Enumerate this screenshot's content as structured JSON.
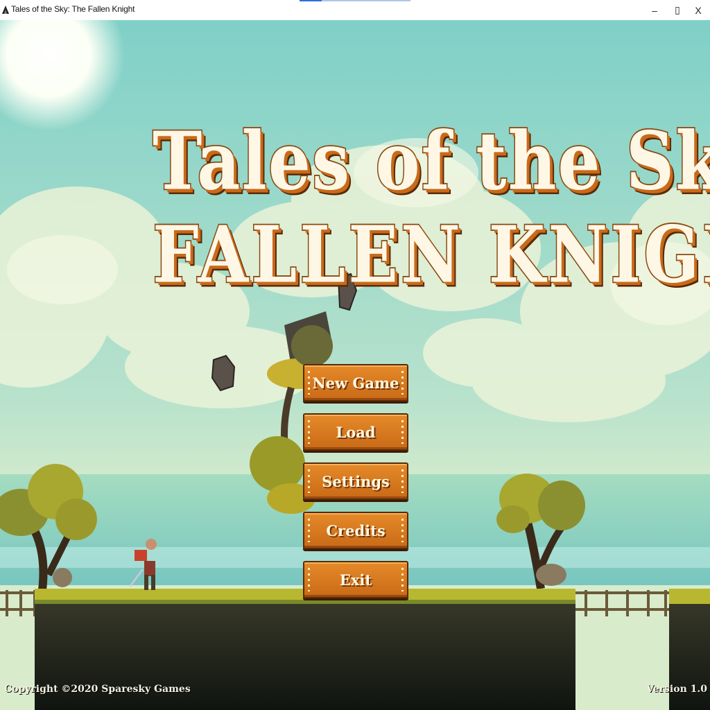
{
  "window": {
    "title": "Tales of the Sky: The Fallen Knight",
    "minimize_glyph": "–",
    "maximize_glyph": "▯",
    "close_glyph": "X"
  },
  "logo": {
    "line1": "Tales of the Sky",
    "line2": "FALLEN KNIGHT"
  },
  "menu": {
    "new_game": "New Game",
    "load": "Load",
    "settings": "Settings",
    "credits": "Credits",
    "exit": "Exit"
  },
  "footer": {
    "copyright": "Copyright ©2020 Sparesky Games",
    "version": "Version 1.0"
  },
  "colors": {
    "button": "#d97a22",
    "logo_outline": "#8a4a10",
    "sky": "#a8dcd0",
    "sea": "#8ed0b8"
  },
  "icons": [
    "app-icon",
    "minimize-icon",
    "maximize-icon",
    "close-icon"
  ]
}
